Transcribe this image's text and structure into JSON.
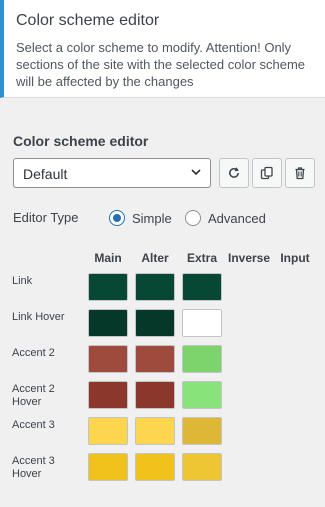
{
  "header": {
    "title": "Color scheme editor",
    "description": "Select a color scheme to modify. Attention! Only sections of the site with the selected color scheme will be affected by the changes"
  },
  "editor": {
    "section_title": "Color scheme editor",
    "scheme_select": {
      "value": "Default"
    },
    "buttons": {
      "reset_icon": "reset-icon",
      "copy_icon": "copy-icon",
      "delete_icon": "trash-icon"
    },
    "editor_type": {
      "label": "Editor Type",
      "options": [
        {
          "label": "Simple",
          "selected": true
        },
        {
          "label": "Advanced",
          "selected": false
        }
      ]
    },
    "columns": [
      "Main",
      "Alter",
      "Extra",
      "Inverse",
      "Input"
    ],
    "rows": [
      {
        "label": "Link",
        "colors": [
          "#074834",
          "#074834",
          "#074834"
        ]
      },
      {
        "label": "Link Hover",
        "colors": [
          "#053829",
          "#053829",
          "#ffffff"
        ]
      },
      {
        "label": "Accent 2",
        "colors": [
          "#9e4a3c",
          "#9e4a3c",
          "#7dd46d"
        ]
      },
      {
        "label": "Accent 2 Hover",
        "colors": [
          "#8b372b",
          "#8b372b",
          "#88e47a"
        ]
      },
      {
        "label": "Accent 3",
        "colors": [
          "#fdd54f",
          "#fdd54f",
          "#ddb735"
        ]
      },
      {
        "label": "Accent 3 Hover",
        "colors": [
          "#f1c11c",
          "#f1c11c",
          "#eec532"
        ]
      }
    ]
  }
}
